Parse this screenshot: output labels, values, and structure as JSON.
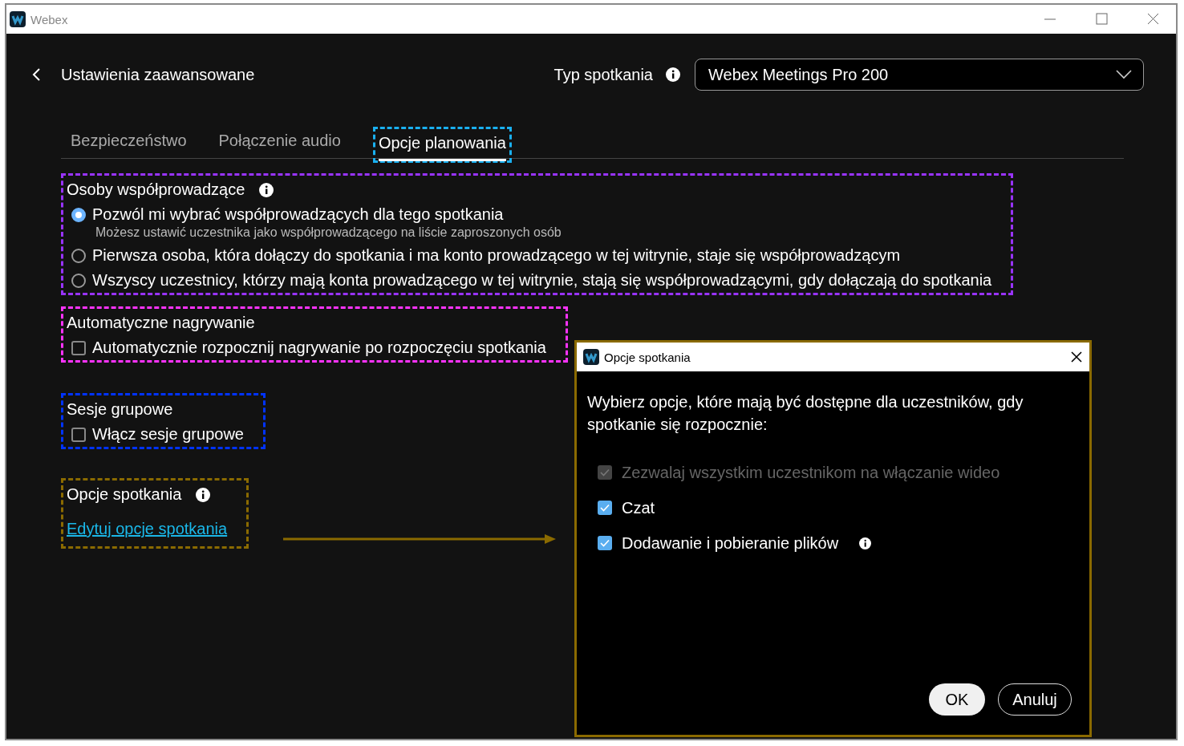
{
  "window": {
    "title": "Webex"
  },
  "header": {
    "title": "Ustawienia zaawansowane",
    "meeting_type_label": "Typ spotkania",
    "meeting_type_value": "Webex Meetings Pro 200"
  },
  "tabs": [
    {
      "label": "Bezpieczeństwo",
      "selected": false
    },
    {
      "label": "Połączenie audio",
      "selected": false
    },
    {
      "label": "Opcje planowania",
      "selected": true
    }
  ],
  "sections": [
    {
      "kind": "radio",
      "color": "#9933ff",
      "title": "Osoby współprowadzące",
      "info": true,
      "options": [
        {
          "label": "Pozwól mi wybrać współprowadzących dla tego spotkania",
          "hint": "Możesz ustawić uczestnika jako współprowadzącego na liście zaproszonych osób",
          "selected": true
        },
        {
          "label": "Pierwsza osoba, która dołączy do spotkania i ma konto prowadzącego w tej witrynie, staje się współprowadzącym",
          "selected": false
        },
        {
          "label": "Wszyscy uczestnicy, którzy mają konta prowadzącego w tej witrynie, stają się współprowadzącymi, gdy dołączają do spotkania",
          "selected": false
        }
      ]
    },
    {
      "kind": "checkbox",
      "color": "#ff33ff",
      "title": "Automatyczne nagrywanie",
      "info": false,
      "options": [
        {
          "label": "Automatycznie rozpocznij nagrywanie po rozpoczęciu spotkania",
          "checked": false
        }
      ]
    },
    {
      "kind": "checkbox",
      "color": "#0033ff",
      "title": "Sesje grupowe",
      "info": false,
      "options": [
        {
          "label": "Włącz sesje grupowe",
          "checked": false
        }
      ]
    },
    {
      "kind": "link",
      "color": "#8a6a00",
      "title": "Opcje spotkania",
      "info": true,
      "link": "Edytuj opcje spotkania"
    }
  ],
  "dialog": {
    "title": "Opcje spotkania",
    "prompt": "Wybierz opcje, które mają być dostępne dla uczestników, gdy spotkanie się rozpocznie:",
    "options": [
      {
        "label": "Zezwalaj wszystkim uczestnikom na włączanie wideo",
        "checked": true,
        "disabled": true,
        "info": false
      },
      {
        "label": "Czat",
        "checked": true,
        "disabled": false,
        "info": false
      },
      {
        "label": "Dodawanie i pobieranie plików",
        "checked": true,
        "disabled": false,
        "info": true
      }
    ],
    "buttons": [
      {
        "label": "OK",
        "primary": true
      },
      {
        "label": "Anuluj",
        "primary": false
      }
    ]
  }
}
